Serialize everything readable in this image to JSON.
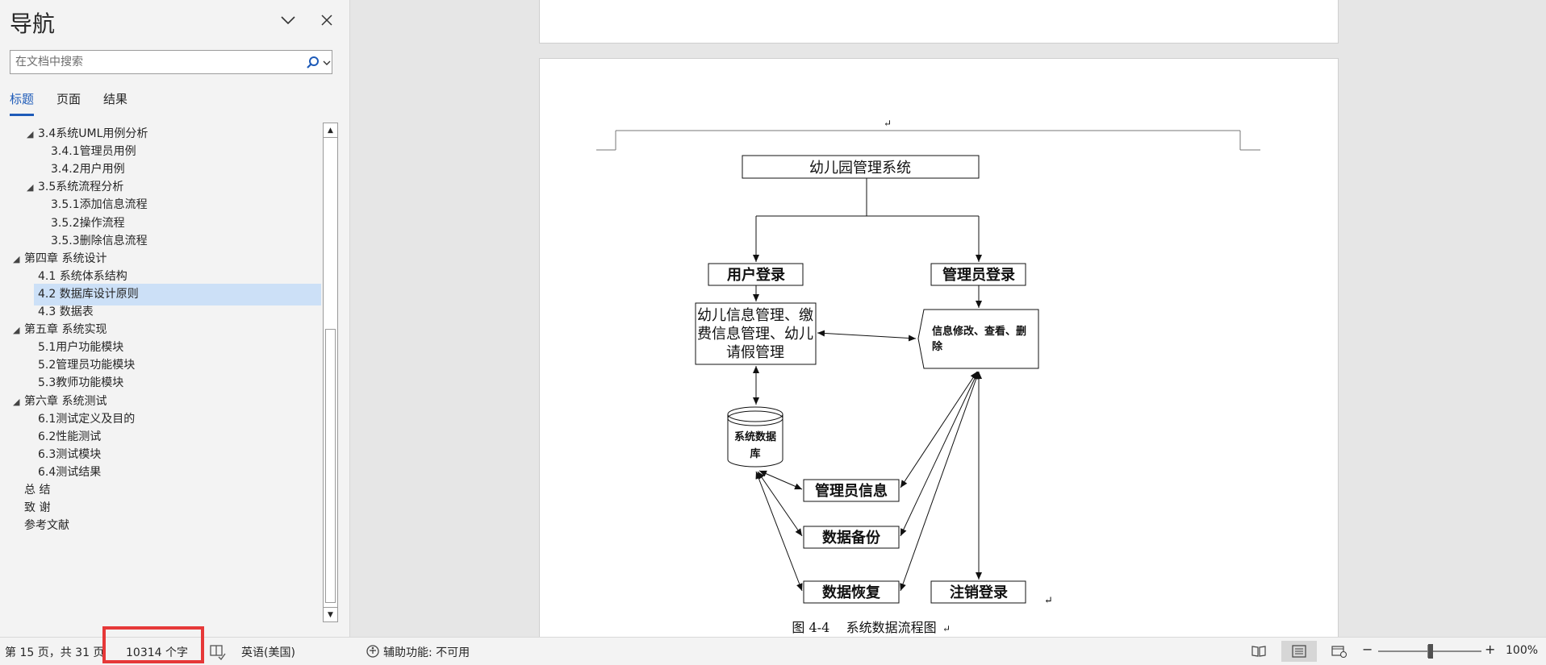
{
  "nav": {
    "title": "导航",
    "search_placeholder": "在文档中搜索",
    "tabs": [
      {
        "label": "标题",
        "active": true
      },
      {
        "label": "页面",
        "active": false
      },
      {
        "label": "结果",
        "active": false
      }
    ],
    "tree": [
      {
        "label": "3.4系统UML用例分析",
        "level": 2,
        "expanded": true
      },
      {
        "label": "3.4.1管理员用例",
        "level": 3
      },
      {
        "label": "3.4.2用户用例",
        "level": 3
      },
      {
        "label": "3.5系统流程分析",
        "level": 2,
        "expanded": true
      },
      {
        "label": "3.5.1添加信息流程",
        "level": 3
      },
      {
        "label": "3.5.2操作流程",
        "level": 3
      },
      {
        "label": "3.5.3删除信息流程",
        "level": 3
      },
      {
        "label": "第四章 系统设计",
        "level": 1,
        "expanded": true
      },
      {
        "label": "4.1 系统体系结构",
        "level": 2
      },
      {
        "label": "4.2 数据库设计原则",
        "level": 2,
        "selected": true
      },
      {
        "label": "4.3 数据表",
        "level": 2
      },
      {
        "label": "第五章 系统实现",
        "level": 1,
        "expanded": true
      },
      {
        "label": "5.1用户功能模块",
        "level": 2
      },
      {
        "label": "5.2管理员功能模块",
        "level": 2
      },
      {
        "label": "5.3教师功能模块",
        "level": 2
      },
      {
        "label": "第六章  系统测试",
        "level": 1,
        "expanded": true
      },
      {
        "label": "6.1测试定义及目的",
        "level": 2
      },
      {
        "label": "6.2性能测试",
        "level": 2
      },
      {
        "label": "6.3测试模块",
        "level": 2
      },
      {
        "label": "6.4测试结果",
        "level": 2
      },
      {
        "label": "总  结",
        "level": 1
      },
      {
        "label": "致  谢",
        "level": 1
      },
      {
        "label": "参考文献",
        "level": 1
      }
    ]
  },
  "document": {
    "flowchart": {
      "root": "幼儿园管理系统",
      "user_login": "用户登录",
      "admin_login": "管理员登录",
      "user_functions": [
        "幼儿信息管理、缴",
        "费信息管理、幼儿",
        "请假管理"
      ],
      "admin_functions": [
        "信息修改、查看、删",
        "除"
      ],
      "database": [
        "系统数据",
        "库"
      ],
      "admin_info": "管理员信息",
      "data_backup": "数据备份",
      "data_restore": "数据恢复",
      "logout": "注销登录",
      "return_mark_1": "↵",
      "return_mark_2": "↵",
      "return_mark_3": "↵"
    },
    "caption": "图 4-4    系统数据流程图"
  },
  "status": {
    "page_info": "第 15 页，共 31 页",
    "word_count": "10314 个字",
    "language": "英语(美国)",
    "accessibility": "辅助功能: 不可用",
    "zoom_level": "100%",
    "active_view": "print-layout"
  },
  "colors": {
    "accent": "#1e5bb8",
    "selection": "#cce0f7",
    "highlight_box": "#e63838"
  }
}
